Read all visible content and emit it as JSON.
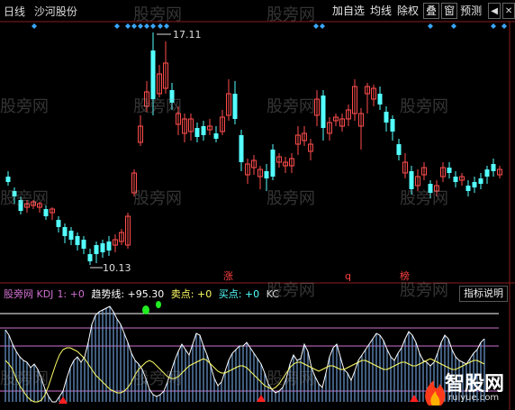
{
  "window": {
    "period": "日线",
    "stock_name": "沙河股份"
  },
  "toolbar": {
    "add_fav": "加自选",
    "ma": "均线",
    "exright": "除权",
    "overlay": "叠",
    "window": "窗",
    "forecast": "预测"
  },
  "price": {
    "high_label": "17.11",
    "low_label": "10.13"
  },
  "markers": {
    "zhang": "涨",
    "q": "q",
    "bang": "榜"
  },
  "indicator": {
    "name": "股旁网 KDJ",
    "k_label": "1: +0",
    "trend_label": "趋势线: +95.30",
    "sell_label": "卖点: +0",
    "buy_label": "买点: +0",
    "kc_label": "KC"
  },
  "help_button": "指标说明",
  "watermark": "股旁网",
  "logo": {
    "name": "智股网",
    "url": "ruiyue.com"
  },
  "colors": {
    "up": "#ff4d4d",
    "down": "#54ffff",
    "diamond": "#3aa7ff",
    "magenta": "#d070d0",
    "yellow": "#ffff66"
  }
}
